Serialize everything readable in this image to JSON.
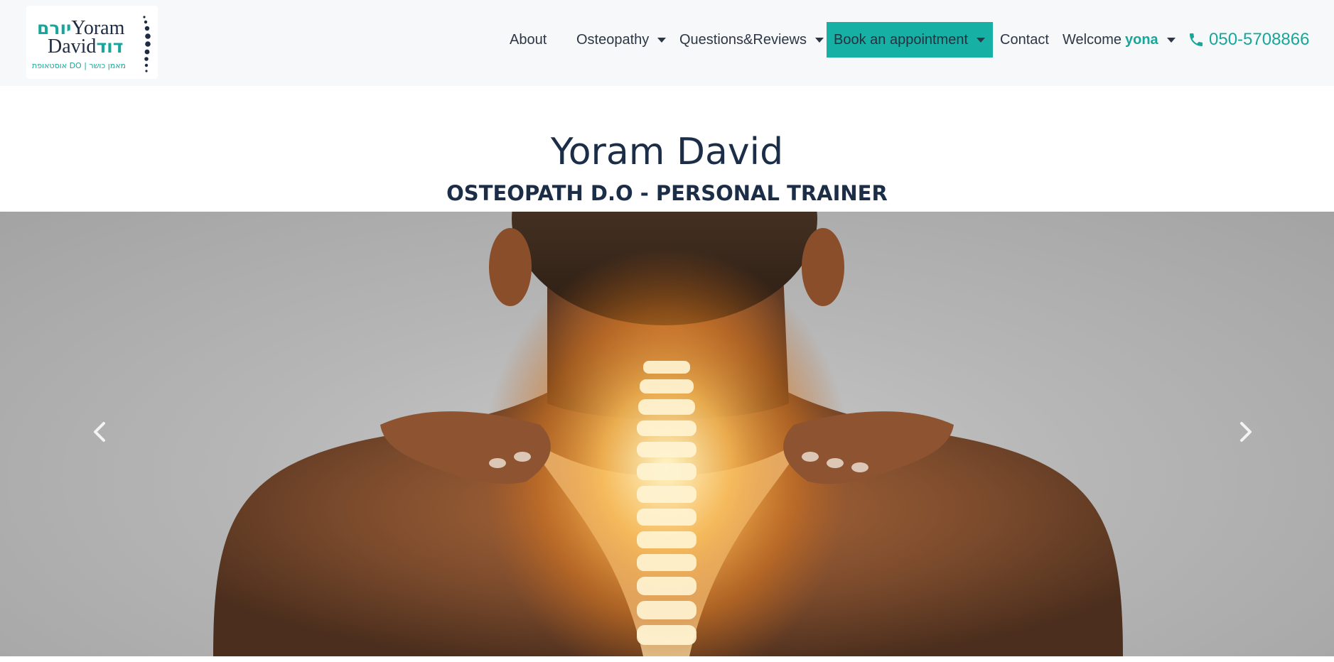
{
  "brand": {
    "logo_english_line1": "Yoram",
    "logo_english_line2": "David",
    "logo_hebrew_line1": "יורם",
    "logo_hebrew_line2": "דוד",
    "logo_tagline": "אוסטאופת DO  |  מאמן כושר"
  },
  "nav": {
    "about": "About",
    "osteopathy": "Osteopathy",
    "questions": "Questions&Reviews",
    "book": "Book an appointment",
    "contact": "Contact",
    "welcome": "Welcome",
    "user": "yona",
    "phone": "050-5708866"
  },
  "hero": {
    "title": "Yoram David",
    "subtitle": "OSTEOPATH D.O - PERSONAL TRAINER"
  },
  "carousel": {
    "prev_icon": "chevron-left-icon",
    "next_icon": "chevron-right-icon",
    "image": "woman-back-glowing-spine-photo"
  },
  "colors": {
    "accent": "#17b0a4",
    "text_dark": "#1c2d48",
    "nav_bg": "#f7f8f9"
  }
}
